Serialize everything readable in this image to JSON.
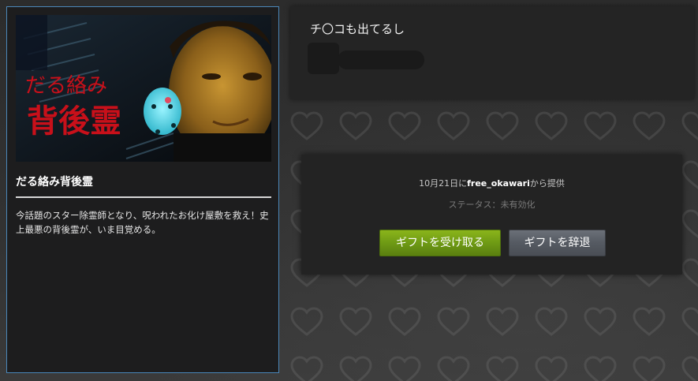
{
  "game": {
    "title": "だる絡み背後霊",
    "banner_text_line1": "だる絡み",
    "banner_text_line2": "背後霊",
    "description": "今話題のスター除霊師となり、呪われたお化け屋敷を救え！史上最悪の背後霊が、いま目覚める。"
  },
  "message": {
    "text": "チ〇コも出てるし"
  },
  "gift": {
    "date": "10月21日に",
    "sender": "free_okawari",
    "from_suffix": "から提供",
    "status": "ステータス：未有効化",
    "accept_label": "ギフトを受け取る",
    "decline_label": "ギフトを辞退"
  },
  "colors": {
    "card_border": "#4a86b8",
    "accept_button": "#7aa41a",
    "decline_button": "#5a5f67",
    "banner_text": "#c8101a",
    "mask": "#4fd6e6"
  }
}
